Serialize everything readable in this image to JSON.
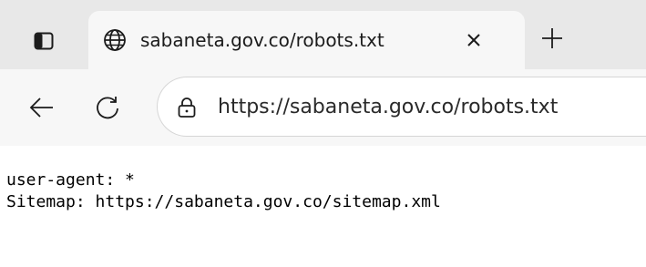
{
  "tab": {
    "title": "sabaneta.gov.co/robots.txt"
  },
  "address_bar": {
    "url": "https://sabaneta.gov.co/robots.txt"
  },
  "icons": {
    "tab_actions": "tab-actions-icon",
    "favicon": "globe-icon",
    "close": "close-icon",
    "new_tab": "plus-icon",
    "back": "back-arrow-icon",
    "refresh": "refresh-icon",
    "lock": "lock-icon"
  },
  "page": {
    "lines": [
      "user-agent: *",
      "Sitemap: https://sabaneta.gov.co/sitemap.xml"
    ]
  },
  "colors": {
    "tab_strip": "#e8e8e8",
    "active_tab": "#f7f7f7",
    "page_background": "#ffffff"
  }
}
